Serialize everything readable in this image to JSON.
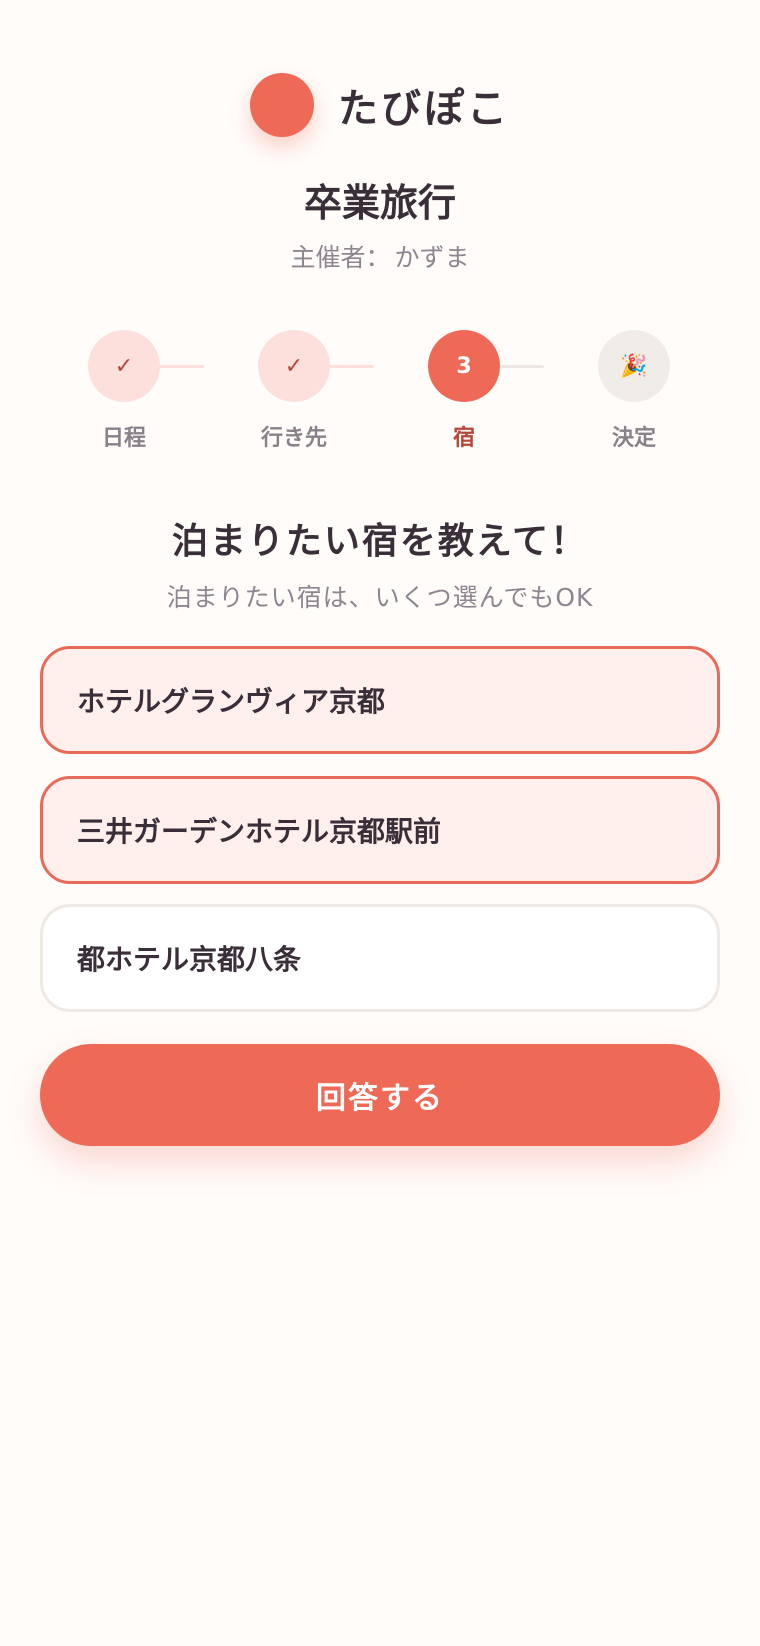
{
  "brand": {
    "name": "たびぽこ",
    "accent_color": "#ee6a57"
  },
  "event": {
    "title": "卒業旅行",
    "organizer_label": "主催者：",
    "organizer_name": "かずま"
  },
  "stepper": {
    "steps": [
      {
        "label": "日程",
        "mark": "✓",
        "status": "done"
      },
      {
        "label": "行き先",
        "mark": "✓",
        "status": "done"
      },
      {
        "label": "宿",
        "mark": "3",
        "status": "active"
      },
      {
        "label": "決定",
        "mark": "🎉",
        "status": "todo",
        "icon": "party-popper-icon"
      }
    ]
  },
  "question": {
    "title": "泊まりたい宿を教えて！",
    "hint": "泊まりたい宿は、いくつ選んでもOK"
  },
  "options": [
    {
      "label": "ホテルグランヴィア京都",
      "selected": true
    },
    {
      "label": "三井ガーデンホテル京都駅前",
      "selected": true
    },
    {
      "label": "都ホテル京都八条",
      "selected": false
    }
  ],
  "submit": {
    "label": "回答する"
  }
}
